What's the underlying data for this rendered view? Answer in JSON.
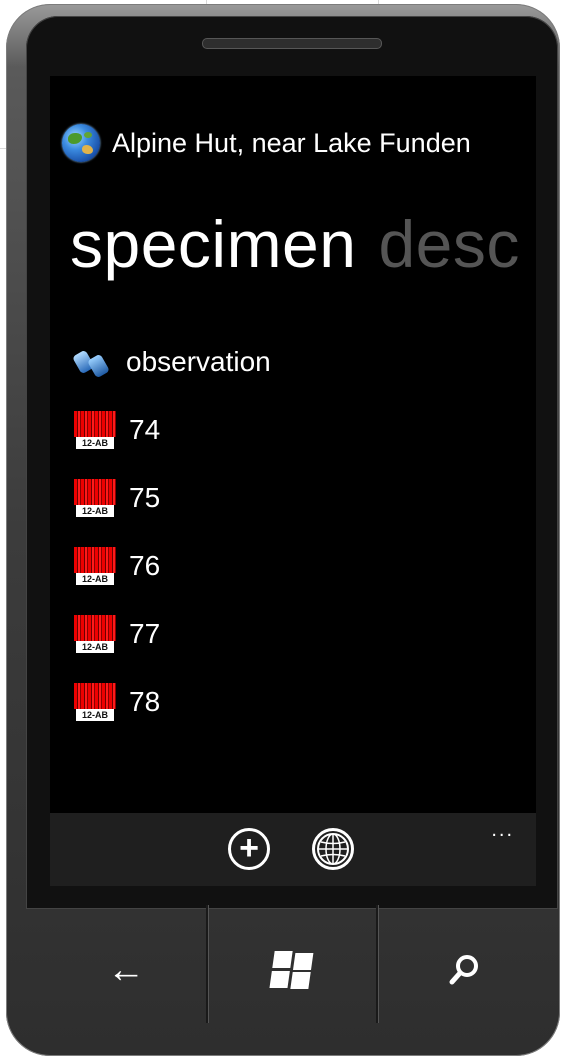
{
  "app": {
    "title": "Alpine Hut, near Lake Funden",
    "title_icon": "globe-icon"
  },
  "pivot": {
    "active_label": "specimen",
    "next_label": "desc"
  },
  "list": {
    "observation": {
      "label": "observation",
      "icon": "binoculars-icon"
    },
    "specimens": [
      {
        "label": "74",
        "icon": "barcode-icon",
        "icon_text": "12-AB"
      },
      {
        "label": "75",
        "icon": "barcode-icon",
        "icon_text": "12-AB"
      },
      {
        "label": "76",
        "icon": "barcode-icon",
        "icon_text": "12-AB"
      },
      {
        "label": "77",
        "icon": "barcode-icon",
        "icon_text": "12-AB"
      },
      {
        "label": "78",
        "icon": "barcode-icon",
        "icon_text": "12-AB"
      }
    ]
  },
  "appbar": {
    "buttons": [
      {
        "icon": "add-icon"
      },
      {
        "icon": "globe-wireframe-icon"
      }
    ],
    "more": "..."
  },
  "hardware": {
    "back": "←",
    "start_icon": "windows-logo-icon",
    "search_icon": "search-icon"
  },
  "colors": {
    "screen_bg": "#000000",
    "inactive_pivot": "#555555",
    "appbar_bg": "#1f1f1f",
    "barcode_red": "#e00000"
  }
}
